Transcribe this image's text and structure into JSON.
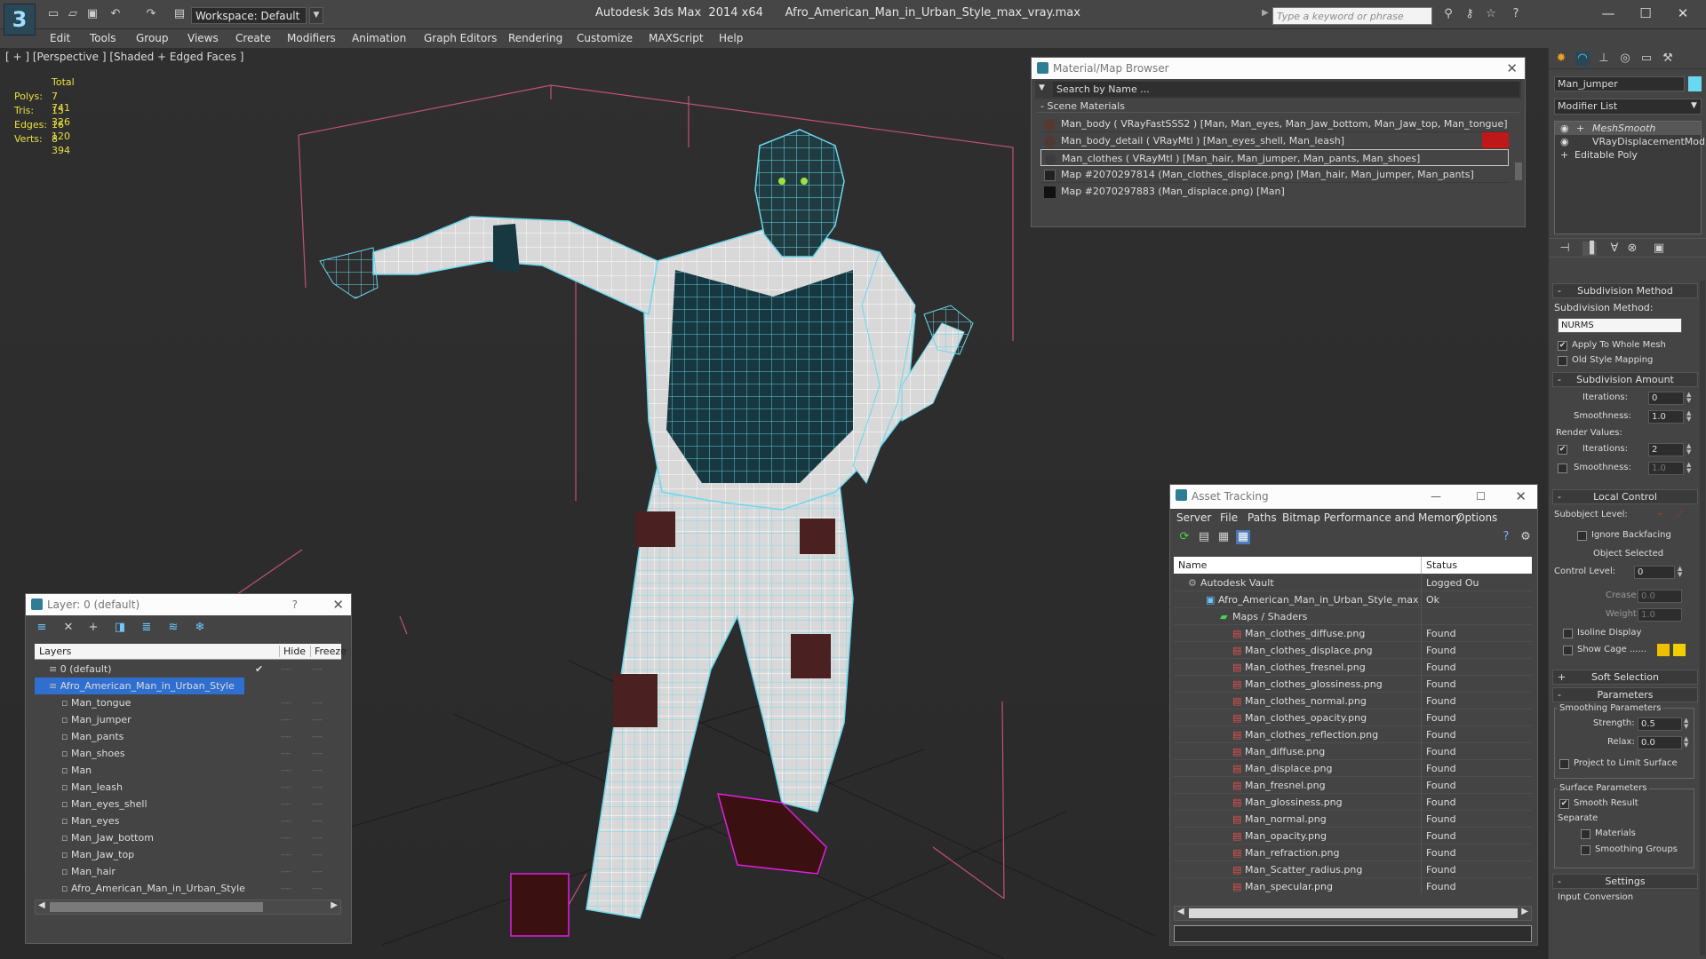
{
  "window": {
    "title": "Autodesk 3ds Max  2014 x64      Afro_American_Man_in_Urban_Style_max_vray.max",
    "search_placeholder": "Type a keyword or phrase",
    "workspace": "Workspace: Default"
  },
  "menu": [
    "Edit",
    "Tools",
    "Group",
    "Views",
    "Create",
    "Modifiers",
    "Animation",
    "Graph Editors",
    "Rendering",
    "Customize",
    "MAXScript",
    "Help"
  ],
  "viewport": {
    "label": "[ + ] [Perspective ] [Shaded + Edged Faces ]",
    "stats": {
      "header": "Total",
      "rows": [
        {
          "k": "Polys:",
          "v": "7 741"
        },
        {
          "k": "Tris:",
          "v": "15 326"
        },
        {
          "k": "Edges:",
          "v": "16 120"
        },
        {
          "k": "Verts:",
          "v": "8 394"
        }
      ]
    }
  },
  "material_browser": {
    "title": "Material/Map Browser",
    "search": "Search by Name ...",
    "section": "Scene Materials",
    "items": [
      "Man_body  ( VRayFastSSS2 ) [Man, Man_eyes, Man_Jaw_bottom, Man_Jaw_top, Man_tongue]",
      "Man_body_detail  ( VRayMtl ) [Man_eyes_shell, Man_leash]",
      "Man_clothes  ( VRayMtl ) [Man_hair, Man_jumper, Man_pants, Man_shoes]",
      "Map #2070297814 (Man_clothes_displace.png) [Man_hair, Man_jumper, Man_pants]",
      "Map #2070297883 (Man_displace.png) [Man]"
    ]
  },
  "layers": {
    "title": "Layer: 0 (default)",
    "help": "?",
    "col_layers": "Layers",
    "col_hide": "Hide",
    "col_freeze": "Freeze",
    "items": [
      {
        "name": "0 (default)",
        "level": 0
      },
      {
        "name": "Afro_American_Man_in_Urban_Style",
        "level": 0
      },
      {
        "name": "Man_tongue",
        "level": 1
      },
      {
        "name": "Man_jumper",
        "level": 1
      },
      {
        "name": "Man_pants",
        "level": 1
      },
      {
        "name": "Man_shoes",
        "level": 1
      },
      {
        "name": "Man",
        "level": 1
      },
      {
        "name": "Man_leash",
        "level": 1
      },
      {
        "name": "Man_eyes_shell",
        "level": 1
      },
      {
        "name": "Man_eyes",
        "level": 1
      },
      {
        "name": "Man_Jaw_bottom",
        "level": 1
      },
      {
        "name": "Man_Jaw_top",
        "level": 1
      },
      {
        "name": "Man_hair",
        "level": 1
      },
      {
        "name": "Afro_American_Man_in_Urban_Style",
        "level": 1
      }
    ]
  },
  "asset_tracking": {
    "title": "Asset Tracking",
    "menu": [
      "Server",
      "File",
      "Paths",
      "Bitmap Performance and Memory",
      "Options"
    ],
    "col_name": "Name",
    "col_status": "Status",
    "rows": [
      {
        "name": "Autodesk Vault",
        "status": "Logged Ou",
        "level": 0
      },
      {
        "name": "Afro_American_Man_in_Urban_Style_max_vray.max",
        "status": "Ok",
        "level": 1
      },
      {
        "name": "Maps / Shaders",
        "status": "",
        "level": 2
      },
      {
        "name": "Man_clothes_diffuse.png",
        "status": "Found",
        "level": 3
      },
      {
        "name": "Man_clothes_displace.png",
        "status": "Found",
        "level": 3
      },
      {
        "name": "Man_clothes_fresnel.png",
        "status": "Found",
        "level": 3
      },
      {
        "name": "Man_clothes_glossiness.png",
        "status": "Found",
        "level": 3
      },
      {
        "name": "Man_clothes_normal.png",
        "status": "Found",
        "level": 3
      },
      {
        "name": "Man_clothes_opacity.png",
        "status": "Found",
        "level": 3
      },
      {
        "name": "Man_clothes_reflection.png",
        "status": "Found",
        "level": 3
      },
      {
        "name": "Man_diffuse.png",
        "status": "Found",
        "level": 3
      },
      {
        "name": "Man_displace.png",
        "status": "Found",
        "level": 3
      },
      {
        "name": "Man_fresnel.png",
        "status": "Found",
        "level": 3
      },
      {
        "name": "Man_glossiness.png",
        "status": "Found",
        "level": 3
      },
      {
        "name": "Man_normal.png",
        "status": "Found",
        "level": 3
      },
      {
        "name": "Man_opacity.png",
        "status": "Found",
        "level": 3
      },
      {
        "name": "Man_refraction.png",
        "status": "Found",
        "level": 3
      },
      {
        "name": "Man_Scatter_radius.png",
        "status": "Found",
        "level": 3
      },
      {
        "name": "Man_specular.png",
        "status": "Found",
        "level": 3
      }
    ]
  },
  "command_panel": {
    "object_name": "Man_jumper",
    "modifier_list": "Modifier List",
    "stack": [
      "MeshSmooth",
      "VRayDisplacementMod",
      "Editable Poly"
    ],
    "subdivision_method": {
      "head": "Subdivision Method",
      "label": "Subdivision Method:",
      "value": "NURMS",
      "apply": "Apply To Whole Mesh",
      "old": "Old Style Mapping"
    },
    "subdivision_amount": {
      "head": "Subdivision Amount",
      "iterations_label": "Iterations:",
      "iterations": "0",
      "smoothness_label": "Smoothness:",
      "smoothness": "1.0",
      "render_values": "Render Values:",
      "r_iterations": "2",
      "r_smoothness": "1.0"
    },
    "local_control": {
      "head": "Local Control",
      "subobject": "Subobject Level:",
      "ignore": "Ignore Backfacing",
      "selected": "Object Selected",
      "control_label": "Control Level:",
      "control": "0",
      "crease_label": "Crease:",
      "crease": "0.0",
      "weight_label": "Weight:",
      "weight": "1.0",
      "isoline": "Isoline Display",
      "cage": "Show Cage ......"
    },
    "soft_selection": {
      "head": "Soft Selection"
    },
    "parameters": {
      "head": "Parameters",
      "smoothing": "Smoothing Parameters",
      "strength_label": "Strength:",
      "strength": "0.5",
      "relax_label": "Relax:",
      "relax": "0.0",
      "project": "Project to Limit Surface",
      "surface": "Surface Parameters",
      "smooth_result": "Smooth Result",
      "separate": "Separate",
      "materials": "Materials",
      "groups": "Smoothing Groups"
    },
    "settings": {
      "head": "Settings",
      "input": "Input Conversion"
    }
  }
}
